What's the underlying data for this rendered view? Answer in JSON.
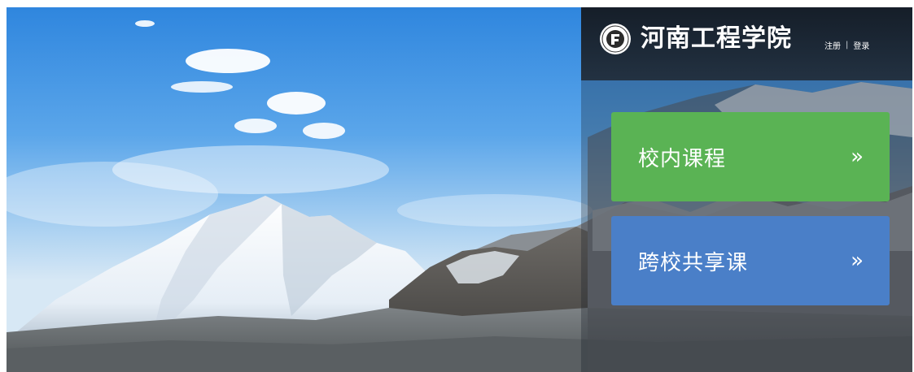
{
  "brand": {
    "name": "河南工程学院",
    "emblem_icon": "university-emblem-icon"
  },
  "auth": {
    "register_label": "注册",
    "separator": "|",
    "login_label": "登录"
  },
  "cards": [
    {
      "label": "校内课程",
      "chevron": "»",
      "color": "#5ab354"
    },
    {
      "label": "跨校共享课",
      "chevron": "»",
      "color": "#4a7fc8"
    }
  ]
}
